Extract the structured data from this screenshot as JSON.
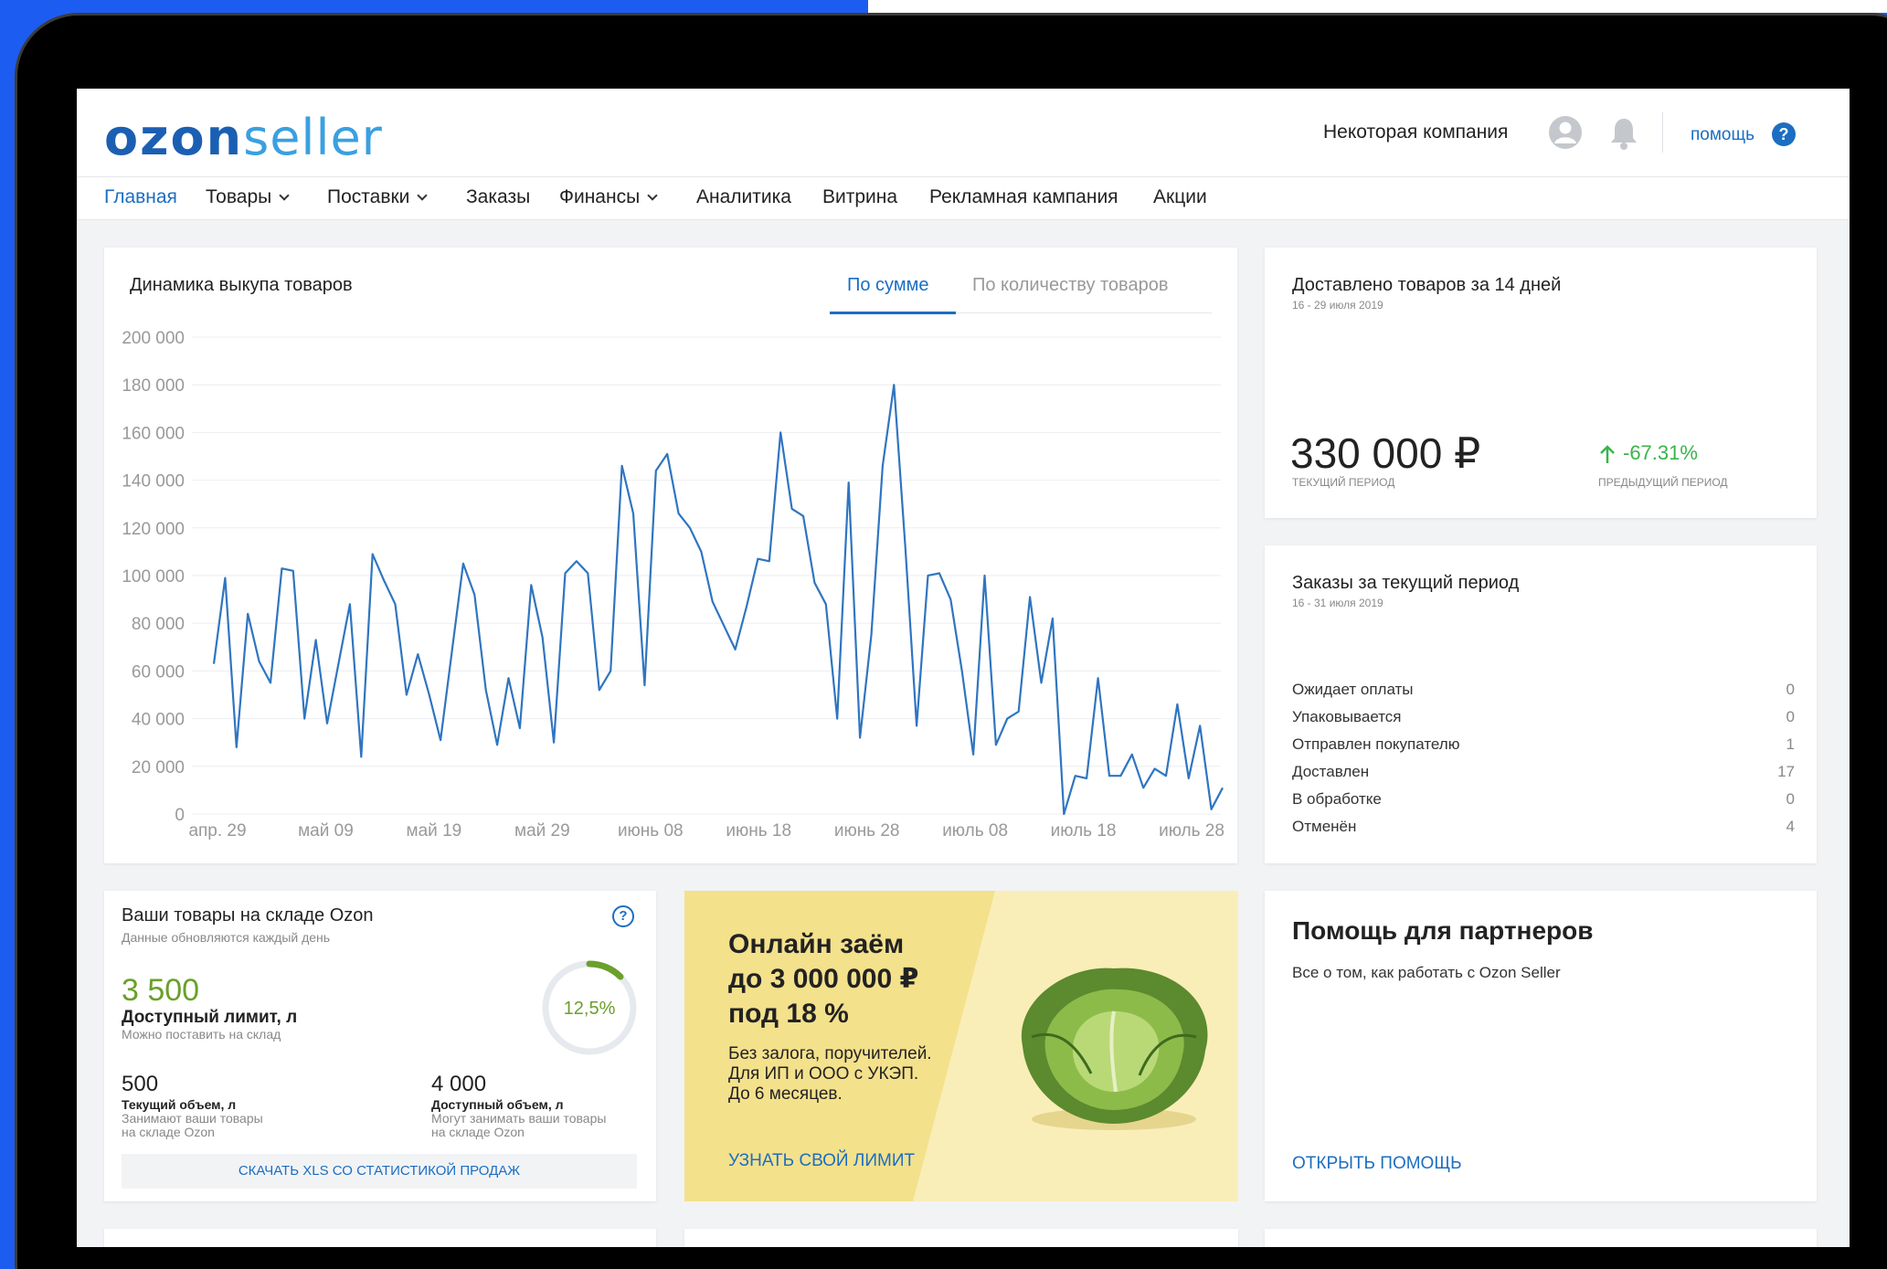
{
  "app": {
    "logo_ozon": "ozon",
    "logo_seller": "seller",
    "company": "Некоторая компания",
    "help_label": "помощь",
    "help_icon": "?"
  },
  "nav": [
    {
      "label": "Главная",
      "active": true,
      "dropdown": false
    },
    {
      "label": "Товары",
      "active": false,
      "dropdown": true
    },
    {
      "label": "Поставки",
      "active": false,
      "dropdown": true
    },
    {
      "label": "Заказы",
      "active": false,
      "dropdown": false
    },
    {
      "label": "Финансы",
      "active": false,
      "dropdown": true
    },
    {
      "label": "Аналитика",
      "active": false,
      "dropdown": false
    },
    {
      "label": "Витрина",
      "active": false,
      "dropdown": false
    },
    {
      "label": "Рекламная кампания",
      "active": false,
      "dropdown": false
    },
    {
      "label": "Акции",
      "active": false,
      "dropdown": false
    }
  ],
  "sales_chart": {
    "title": "Динамика выкупа товаров",
    "tabs": [
      {
        "label": "По сумме",
        "active": true
      },
      {
        "label": "По количеству товаров",
        "active": false
      }
    ]
  },
  "chart_data": {
    "type": "line",
    "title": "Динамика выкупа товаров",
    "xlabel": "",
    "ylabel": "",
    "ylim": [
      0,
      200000
    ],
    "yticks": [
      0,
      20000,
      40000,
      60000,
      80000,
      100000,
      120000,
      140000,
      160000,
      180000,
      200000
    ],
    "ytick_labels": [
      "0",
      "20 000",
      "40 000",
      "60 000",
      "80 000",
      "100 000",
      "120 000",
      "140 000",
      "160 000",
      "180 000",
      "200 000"
    ],
    "xtick_labels": [
      "апр. 29",
      "май 09",
      "май 19",
      "май 29",
      "июнь 08",
      "июнь 18",
      "июнь 28",
      "июль 08",
      "июль 18",
      "июль 28"
    ],
    "x_start": "апр. 29",
    "x_end": "июль 28",
    "grid": true,
    "color": "#2f75c0",
    "values": [
      63000,
      99000,
      28000,
      84000,
      64000,
      55000,
      103000,
      102000,
      40000,
      73000,
      38000,
      63000,
      88000,
      24000,
      109000,
      98000,
      88000,
      50000,
      67000,
      50000,
      31000,
      68000,
      105000,
      92000,
      52000,
      29000,
      57000,
      36000,
      96000,
      74000,
      30000,
      101000,
      106000,
      101000,
      52000,
      60000,
      146000,
      126000,
      54000,
      144000,
      151000,
      126000,
      120000,
      110000,
      89000,
      79000,
      69000,
      87000,
      107000,
      106000,
      160000,
      128000,
      125000,
      97000,
      88000,
      40000,
      139000,
      32000,
      75000,
      146000,
      180000,
      112000,
      37000,
      100000,
      101000,
      90000,
      60000,
      25000,
      100000,
      29000,
      40000,
      43000,
      91000,
      55000,
      82000,
      0,
      16000,
      15000,
      57000,
      16000,
      16000,
      25000,
      11000,
      19000,
      16000,
      46000,
      15000,
      37000,
      2000,
      11000
    ]
  },
  "delivered": {
    "title": "Доставлено товаров за 14 дней",
    "period": "16 - 29 июля 2019",
    "amount": "330 000 ₽",
    "amount_label": "текущий период",
    "delta": "-67.31%",
    "delta_label": "предыдущий период",
    "delta_color": "#39b44a"
  },
  "orders": {
    "title": "Заказы за текущий период",
    "period": "16 - 31 июля 2019",
    "rows": [
      {
        "label": "Ожидает оплаты",
        "value": "0"
      },
      {
        "label": "Упаковывается",
        "value": "0"
      },
      {
        "label": "Отправлен покупателю",
        "value": "1"
      },
      {
        "label": "Доставлен",
        "value": "17"
      },
      {
        "label": "В обработке",
        "value": "0"
      },
      {
        "label": "Отменён",
        "value": "4"
      }
    ]
  },
  "warehouse": {
    "title": "Ваши товары на складе Ozon",
    "subtitle": "Данные обновляются каждый день",
    "available": "3 500",
    "available_label": "Доступный лимит, л",
    "available_sub": "Можно поставить на склад",
    "percent": "12,5%",
    "percent_value": 0.125,
    "current": "500",
    "current_label": "Текущий объем, л",
    "current_sub_1": "Занимают ваши товары",
    "current_sub_2": "на складе Ozon",
    "avail_vol": "4 000",
    "avail_vol_label": "Доступный объем, л",
    "avail_vol_sub_1": "Могут занимать ваши товары",
    "avail_vol_sub_2": "на складе Ozon",
    "button": "Скачать XLS со статистикой продаж",
    "help_icon": "?"
  },
  "banner": {
    "title_1": "Онлайн заём",
    "title_2": "до 3 000 000 ₽",
    "title_3": "под 18 %",
    "text_1": "Без залога, поручителей.",
    "text_2": "Для ИП и ООО с УКЭП.",
    "text_3": "До 6 месяцев.",
    "link": "Узнать свой лимит"
  },
  "partners": {
    "title": "Помощь для партнеров",
    "subtitle": "Все о том, как работать с Ozon Seller",
    "link": "Открыть помощь"
  },
  "colors": {
    "accent": "#1b6ec2",
    "green": "#6aa02b",
    "banner_bg": "#f4e18c"
  }
}
